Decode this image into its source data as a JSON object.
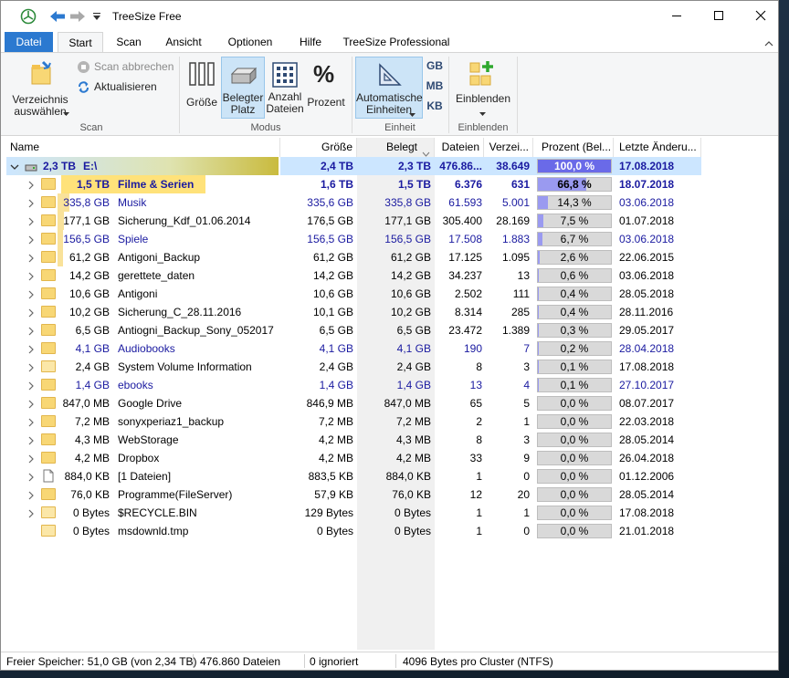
{
  "window": {
    "title": "TreeSize Free"
  },
  "tabs": [
    "Datei",
    "Start",
    "Scan",
    "Ansicht",
    "Optionen",
    "Hilfe",
    "TreeSize Professional"
  ],
  "ribbon": {
    "choose_dir": "Verzeichnis auswählen",
    "cancel_scan": "Scan abbrechen",
    "refresh": "Aktualisieren",
    "size": "Größe",
    "allocated": "Belegter Platz",
    "file_count": "Anzahl Dateien",
    "percent": "Prozent",
    "percent_glyph": "%",
    "auto_units": "Automatische Einheiten",
    "gb": "GB",
    "mb": "MB",
    "kb": "KB",
    "show": "Einblenden",
    "groups": [
      "Scan",
      "Modus",
      "Einheit",
      "Einblenden"
    ]
  },
  "columns": [
    "Name",
    "Größe",
    "Belegt",
    "Dateien",
    "Verzei...",
    "Prozent (Bel...",
    "Letzte Änderu..."
  ],
  "root": {
    "size": "2,3 TB",
    "name": "E:\\",
    "groesse": "2,4 TB",
    "belegt": "2,3 TB",
    "dateien": "476.86...",
    "verz": "38.649",
    "prozent": "100,0 %",
    "pct_value": 100.0,
    "datum": "17.08.2018"
  },
  "rows": [
    {
      "size": "1,5 TB",
      "name": "Filme & Serien",
      "groesse": "1,6 TB",
      "belegt": "1,5 TB",
      "dateien": "6.376",
      "verz": "631",
      "prozent": "66,8 %",
      "pct_value": 66.8,
      "datum": "18.07.2018",
      "style": "selected",
      "expandable": true,
      "folder": "normal",
      "size_fill": 1.0
    },
    {
      "size": "335,8 GB",
      "name": "Musik",
      "groesse": "335,6 GB",
      "belegt": "335,8 GB",
      "dateien": "61.593",
      "verz": "5.001",
      "prozent": "14,3 %",
      "pct_value": 14.3,
      "datum": "03.06.2018",
      "style": "blue",
      "expandable": true,
      "folder": "normal",
      "size_fill": 0.22
    },
    {
      "size": "177,1 GB",
      "name": "Sicherung_Kdf_01.06.2014",
      "groesse": "176,5 GB",
      "belegt": "177,1 GB",
      "dateien": "305.400",
      "verz": "28.169",
      "prozent": "7,5 %",
      "pct_value": 7.5,
      "datum": "01.07.2018",
      "style": "normal",
      "expandable": true,
      "folder": "normal",
      "size_fill": 0.12
    },
    {
      "size": "156,5 GB",
      "name": "Spiele",
      "groesse": "156,5 GB",
      "belegt": "156,5 GB",
      "dateien": "17.508",
      "verz": "1.883",
      "prozent": "6,7 %",
      "pct_value": 6.7,
      "datum": "03.06.2018",
      "style": "blue",
      "expandable": true,
      "folder": "normal",
      "size_fill": 0.1
    },
    {
      "size": "61,2 GB",
      "name": "Antigoni_Backup",
      "groesse": "61,2 GB",
      "belegt": "61,2 GB",
      "dateien": "17.125",
      "verz": "1.095",
      "prozent": "2,6 %",
      "pct_value": 2.6,
      "datum": "22.06.2015",
      "style": "normal",
      "expandable": true,
      "folder": "normal",
      "size_fill": 0.04
    },
    {
      "size": "14,2 GB",
      "name": "gerettete_daten",
      "groesse": "14,2 GB",
      "belegt": "14,2 GB",
      "dateien": "34.237",
      "verz": "13",
      "prozent": "0,6 %",
      "pct_value": 0.6,
      "datum": "03.06.2018",
      "style": "normal",
      "expandable": true,
      "folder": "normal",
      "size_fill": 0
    },
    {
      "size": "10,6 GB",
      "name": "Antigoni",
      "groesse": "10,6 GB",
      "belegt": "10,6 GB",
      "dateien": "2.502",
      "verz": "111",
      "prozent": "0,4 %",
      "pct_value": 0.4,
      "datum": "28.05.2018",
      "style": "normal",
      "expandable": true,
      "folder": "normal",
      "size_fill": 0
    },
    {
      "size": "10,2 GB",
      "name": "Sicherung_C_28.11.2016",
      "groesse": "10,1 GB",
      "belegt": "10,2 GB",
      "dateien": "8.314",
      "verz": "285",
      "prozent": "0,4 %",
      "pct_value": 0.4,
      "datum": "28.11.2016",
      "style": "normal",
      "expandable": true,
      "folder": "normal",
      "size_fill": 0
    },
    {
      "size": "6,5 GB",
      "name": "Antiogni_Backup_Sony_052017",
      "groesse": "6,5 GB",
      "belegt": "6,5 GB",
      "dateien": "23.472",
      "verz": "1.389",
      "prozent": "0,3 %",
      "pct_value": 0.3,
      "datum": "29.05.2017",
      "style": "normal",
      "expandable": true,
      "folder": "normal",
      "size_fill": 0
    },
    {
      "size": "4,1 GB",
      "name": "Audiobooks",
      "groesse": "4,1 GB",
      "belegt": "4,1 GB",
      "dateien": "190",
      "verz": "7",
      "prozent": "0,2 %",
      "pct_value": 0.2,
      "datum": "28.04.2018",
      "style": "blue",
      "expandable": true,
      "folder": "normal",
      "size_fill": 0
    },
    {
      "size": "2,4 GB",
      "name": "System Volume Information",
      "groesse": "2,4 GB",
      "belegt": "2,4 GB",
      "dateien": "8",
      "verz": "3",
      "prozent": "0,1 %",
      "pct_value": 0.1,
      "datum": "17.08.2018",
      "style": "normal",
      "expandable": true,
      "folder": "pale",
      "size_fill": 0
    },
    {
      "size": "1,4 GB",
      "name": "ebooks",
      "groesse": "1,4 GB",
      "belegt": "1,4 GB",
      "dateien": "13",
      "verz": "4",
      "prozent": "0,1 %",
      "pct_value": 0.1,
      "datum": "27.10.2017",
      "style": "blue",
      "expandable": true,
      "folder": "normal",
      "size_fill": 0
    },
    {
      "size": "847,0 MB",
      "name": "Google Drive",
      "groesse": "846,9 MB",
      "belegt": "847,0 MB",
      "dateien": "65",
      "verz": "5",
      "prozent": "0,0 %",
      "pct_value": 0.0,
      "datum": "08.07.2017",
      "style": "normal",
      "expandable": true,
      "folder": "normal",
      "size_fill": 0
    },
    {
      "size": "7,2 MB",
      "name": "sonyxperiaz1_backup",
      "groesse": "7,2 MB",
      "belegt": "7,2 MB",
      "dateien": "2",
      "verz": "1",
      "prozent": "0,0 %",
      "pct_value": 0.0,
      "datum": "22.03.2018",
      "style": "normal",
      "expandable": true,
      "folder": "normal",
      "size_fill": 0
    },
    {
      "size": "4,3 MB",
      "name": "WebStorage",
      "groesse": "4,2 MB",
      "belegt": "4,3 MB",
      "dateien": "8",
      "verz": "3",
      "prozent": "0,0 %",
      "pct_value": 0.0,
      "datum": "28.05.2014",
      "style": "normal",
      "expandable": true,
      "folder": "normal",
      "size_fill": 0
    },
    {
      "size": "4,2 MB",
      "name": "Dropbox",
      "groesse": "4,2 MB",
      "belegt": "4,2 MB",
      "dateien": "33",
      "verz": "9",
      "prozent": "0,0 %",
      "pct_value": 0.0,
      "datum": "26.04.2018",
      "style": "normal",
      "expandable": true,
      "folder": "normal",
      "size_fill": 0
    },
    {
      "size": "884,0 KB",
      "name": "[1 Dateien]",
      "groesse": "883,5 KB",
      "belegt": "884,0 KB",
      "dateien": "1",
      "verz": "0",
      "prozent": "0,0 %",
      "pct_value": 0.0,
      "datum": "01.12.2006",
      "style": "normal",
      "expandable": true,
      "folder": "file",
      "size_fill": 0
    },
    {
      "size": "76,0 KB",
      "name": "Programme(FileServer)",
      "groesse": "57,9 KB",
      "belegt": "76,0 KB",
      "dateien": "12",
      "verz": "20",
      "prozent": "0,0 %",
      "pct_value": 0.0,
      "datum": "28.05.2014",
      "style": "normal",
      "expandable": true,
      "folder": "normal",
      "size_fill": 0
    },
    {
      "size": "0 Bytes",
      "name": "$RECYCLE.BIN",
      "groesse": "129 Bytes",
      "belegt": "0 Bytes",
      "dateien": "1",
      "verz": "1",
      "prozent": "0,0 %",
      "pct_value": 0.0,
      "datum": "17.08.2018",
      "style": "normal",
      "expandable": true,
      "folder": "pale",
      "size_fill": 0
    },
    {
      "size": "0 Bytes",
      "name": "msdownld.tmp",
      "groesse": "0 Bytes",
      "belegt": "0 Bytes",
      "dateien": "1",
      "verz": "0",
      "prozent": "0,0 %",
      "pct_value": 0.0,
      "datum": "21.01.2018",
      "style": "normal",
      "expandable": false,
      "folder": "pale",
      "size_fill": 0
    }
  ],
  "status": {
    "free": "Freier Speicher: 51,0 GB  (von 2,34 TB)",
    "files": "476.860  Dateien",
    "ignored": "0 ignoriert",
    "cluster": "4096  Bytes pro Cluster (NTFS)"
  },
  "colors": {
    "selected_row": "#cce6ff",
    "blue_text": "#1a1aa0",
    "bar_fill": "#9a9af0",
    "folder": "#f8d775",
    "ribbon_file_tab": "#2b79d0"
  }
}
